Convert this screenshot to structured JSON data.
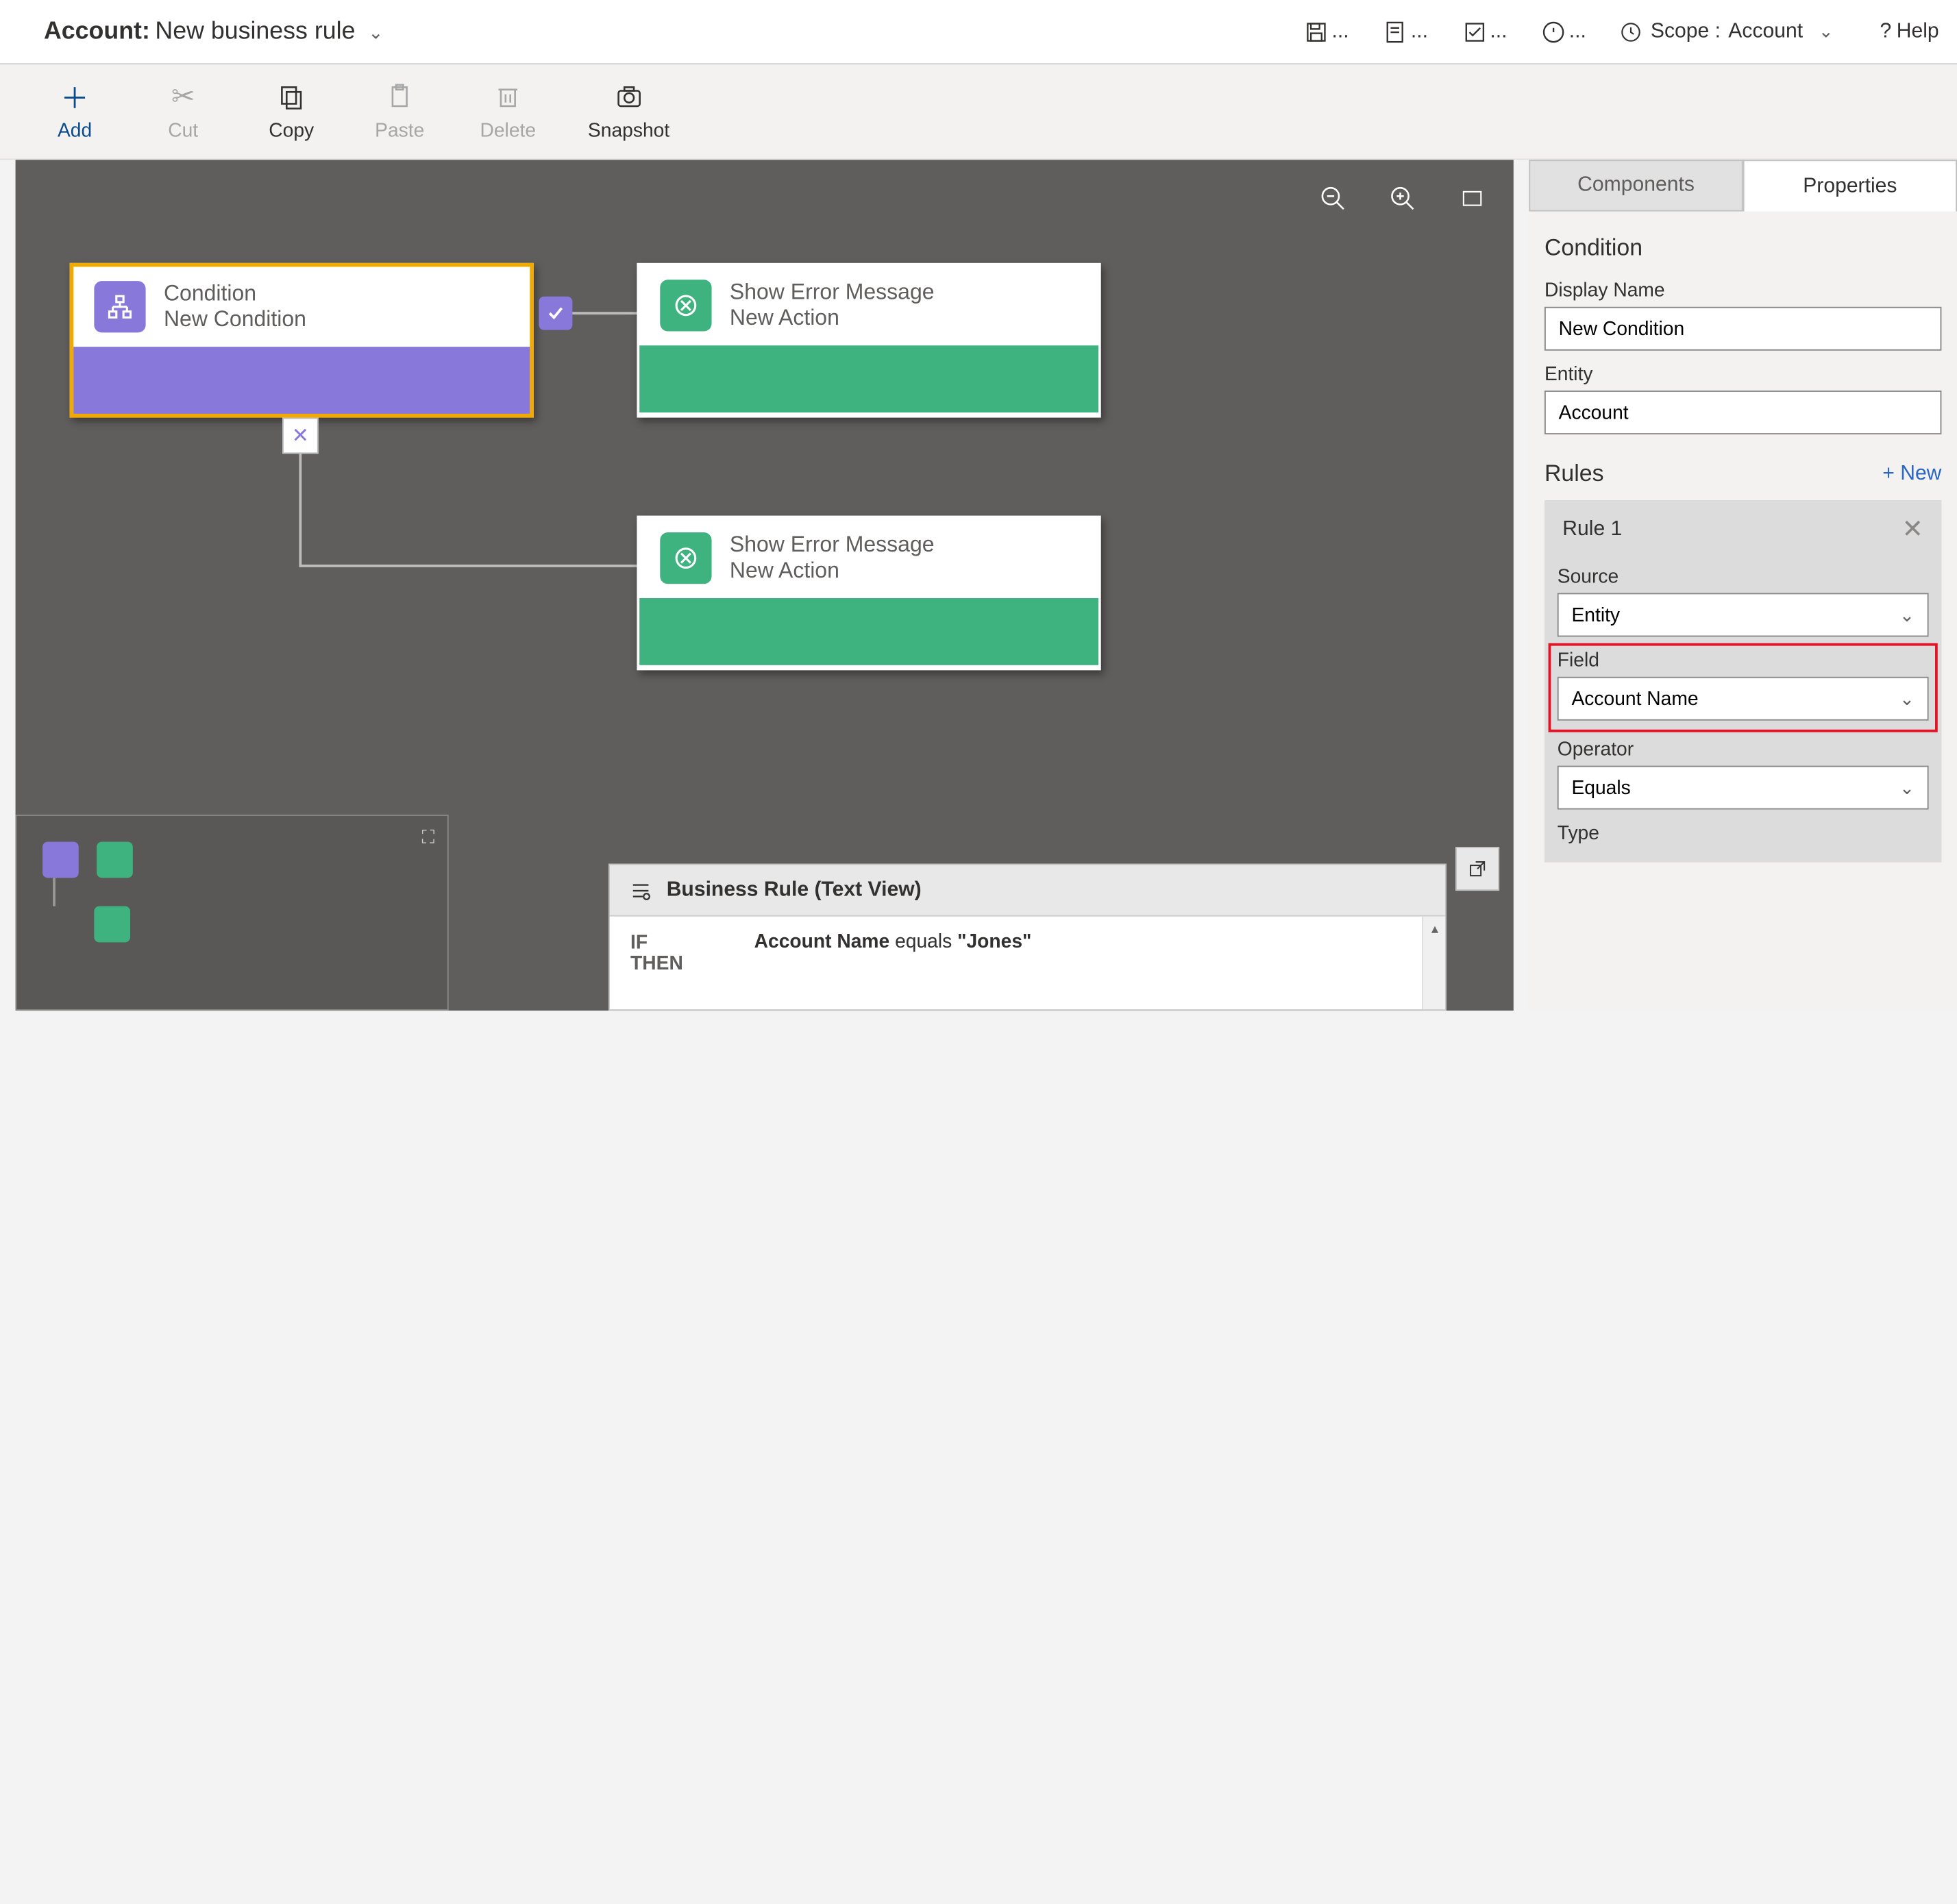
{
  "header": {
    "title_prefix": "Account:",
    "title_name": "New business rule",
    "scope_label": "Scope :",
    "scope_value": "Account",
    "help_label": "Help"
  },
  "toolbar": {
    "add": "Add",
    "cut": "Cut",
    "copy": "Copy",
    "paste": "Paste",
    "delete": "Delete",
    "snapshot": "Snapshot"
  },
  "canvas": {
    "condition_node": {
      "title": "Condition",
      "subtitle": "New Condition"
    },
    "action_node_1": {
      "title": "Show Error Message",
      "subtitle": "New Action"
    },
    "action_node_2": {
      "title": "Show Error Message",
      "subtitle": "New Action"
    }
  },
  "textview": {
    "heading": "Business Rule (Text View)",
    "if": "IF",
    "then": "THEN",
    "cond_field": "Account Name",
    "cond_op": "equals",
    "cond_val": "\"Jones\""
  },
  "panel": {
    "tabs": {
      "components": "Components",
      "properties": "Properties"
    },
    "section_heading": "Condition",
    "display_name_label": "Display Name",
    "display_name_value": "New Condition",
    "entity_label": "Entity",
    "entity_value": "Account",
    "rules_label": "Rules",
    "new_label": "+  New",
    "rule1": {
      "title": "Rule 1",
      "source_label": "Source",
      "source_value": "Entity",
      "field_label": "Field",
      "field_value": "Account Name",
      "operator_label": "Operator",
      "operator_value": "Equals",
      "type_label": "Type"
    }
  }
}
